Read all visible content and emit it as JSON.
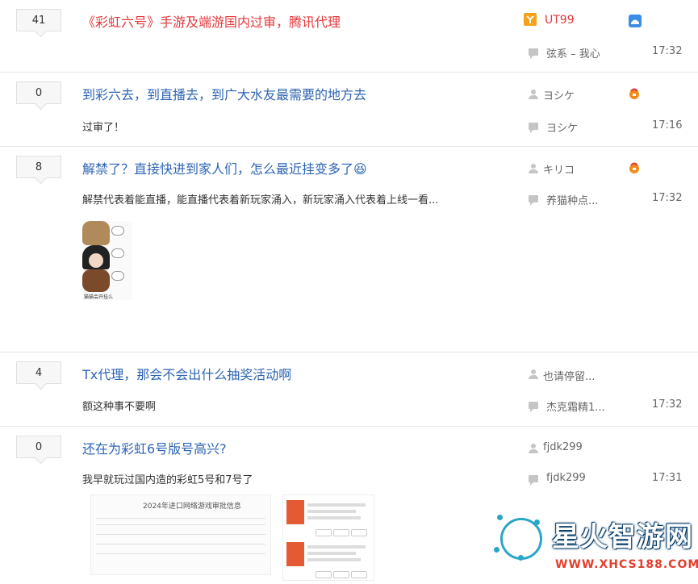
{
  "threads": [
    {
      "reply_count": "41",
      "title": "《彩虹六号》手游及端游国内过审，腾讯代理",
      "abstract": "",
      "author": "UT99",
      "last_reply_user": "弦系 – 我心",
      "last_reply_time": "17:32"
    },
    {
      "reply_count": "0",
      "title": "到彩六去，到直播去，到广大水友最需要的地方去",
      "abstract": "过审了！",
      "author": "ヨシケ",
      "last_reply_user": "ヨシケ",
      "last_reply_time": "17:16"
    },
    {
      "reply_count": "8",
      "title": "解禁了？直接快进到家人们，怎么最近挂变多了😆",
      "abstract": "解禁代表着能直播，能直播代表着新玩家涌入，新玩家涌入代表着上线一看...",
      "author": "キリコ",
      "last_reply_user": "养猫种点...",
      "last_reply_time": "17:32",
      "sticker_caption": "猫猫会开挂么"
    },
    {
      "reply_count": "4",
      "title": "Tx代理，那会不会出什么抽奖活动啊",
      "abstract": "额这种事不要啊",
      "author": "也请停留...",
      "last_reply_user": "杰克霜精1...",
      "last_reply_time": "17:32"
    },
    {
      "reply_count": "0",
      "title": "还在为彩虹6号版号高兴?",
      "abstract": "我早就玩过国内造的彩虹5号和7号了",
      "author": "fjdk299",
      "last_reply_user": "fjdk299",
      "last_reply_time": "17:31",
      "image_caption": "2024年进口网络游戏审批信息"
    }
  ],
  "watermark": {
    "text": "星火智游网",
    "url": "WWW.XHCS188.COM"
  },
  "colors": {
    "title_blue": "#2d64b3",
    "title_red": "#e4393c",
    "watermark_red": "#e23f2d"
  }
}
